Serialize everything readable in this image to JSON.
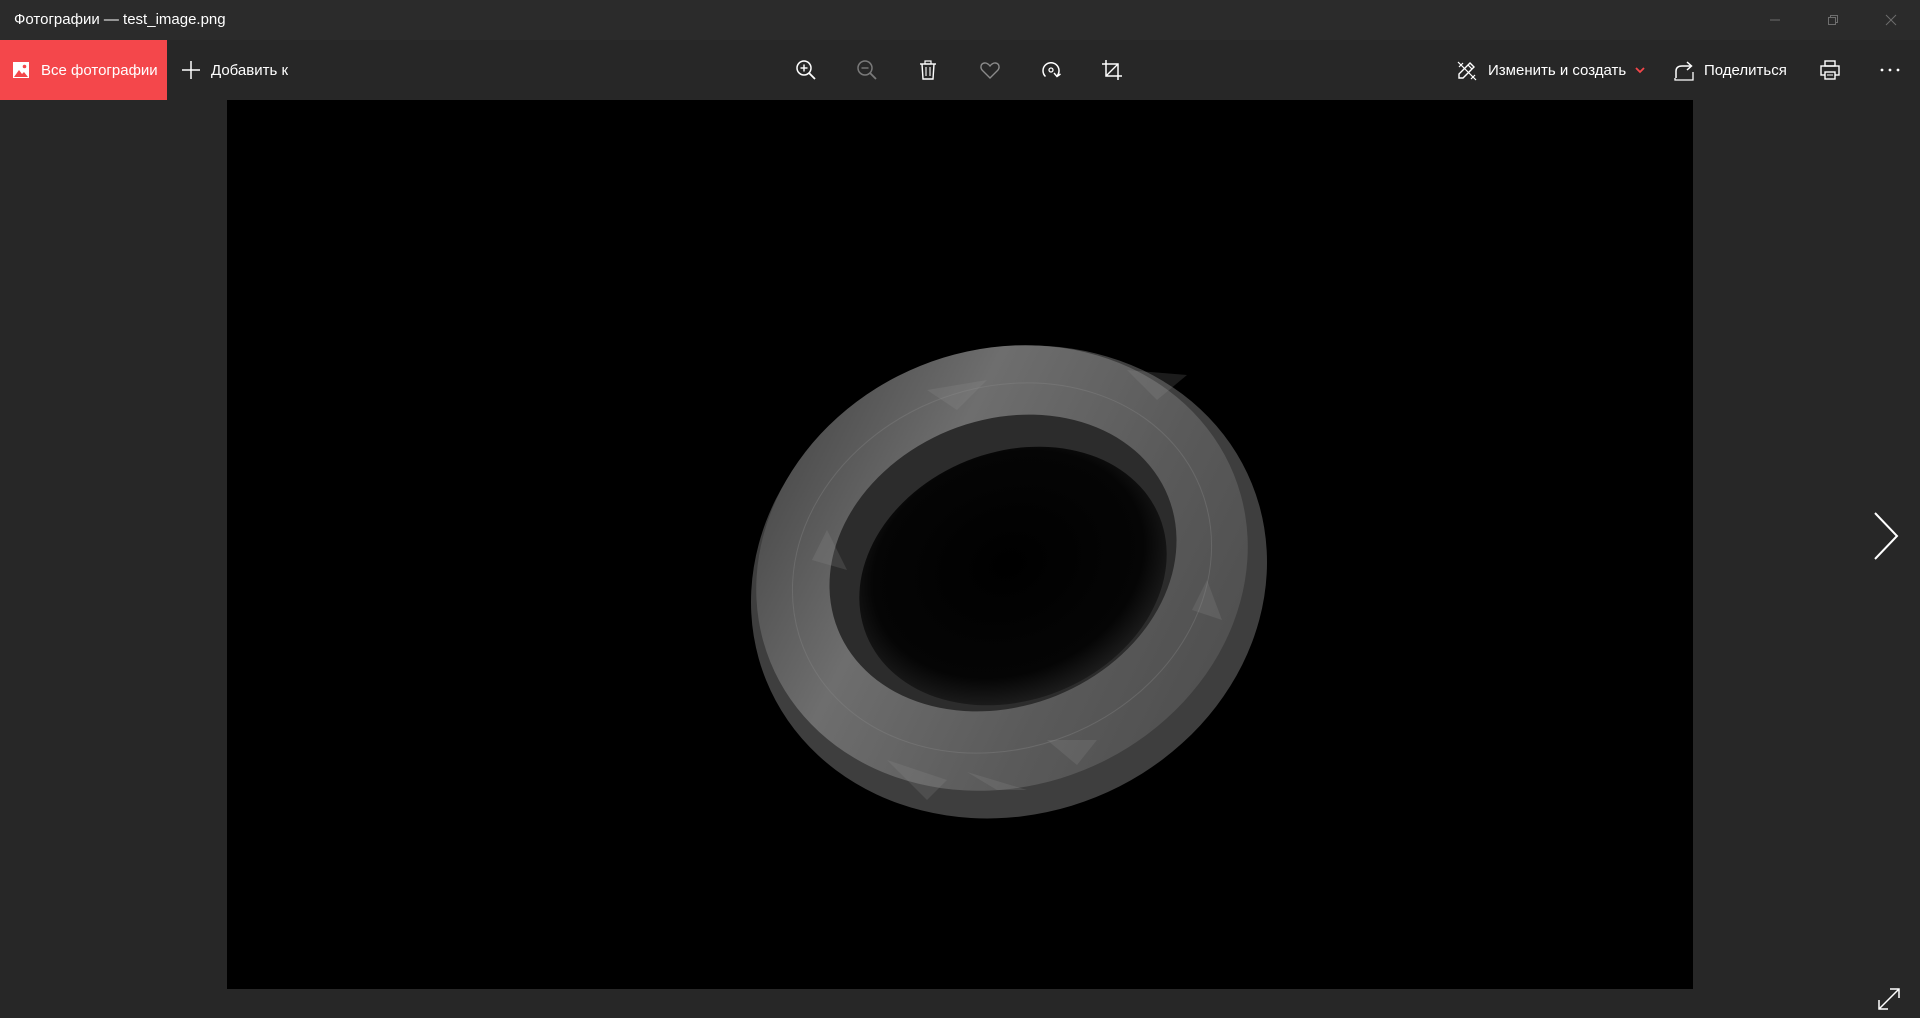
{
  "window": {
    "title": "Фотографии — test_image.png"
  },
  "toolbar": {
    "all_photos_label": "Все фотографии",
    "add_to_label": "Добавить к",
    "edit_create_label": "Изменить и создать",
    "share_label": "Поделиться"
  },
  "icons": {
    "zoom_in": "zoom-in-icon",
    "zoom_out": "zoom-out-icon",
    "delete": "trash-icon",
    "favorite": "heart-icon",
    "rotate": "rotate-icon",
    "crop": "crop-icon",
    "edit": "edit-create-icon",
    "share": "share-icon",
    "print": "printer-icon",
    "more": "more-icon",
    "next": "chevron-right-icon",
    "fullscreen": "expand-icon"
  },
  "colors": {
    "accent": "#f4474b",
    "background": "#272727",
    "viewer_background": "#000000"
  }
}
